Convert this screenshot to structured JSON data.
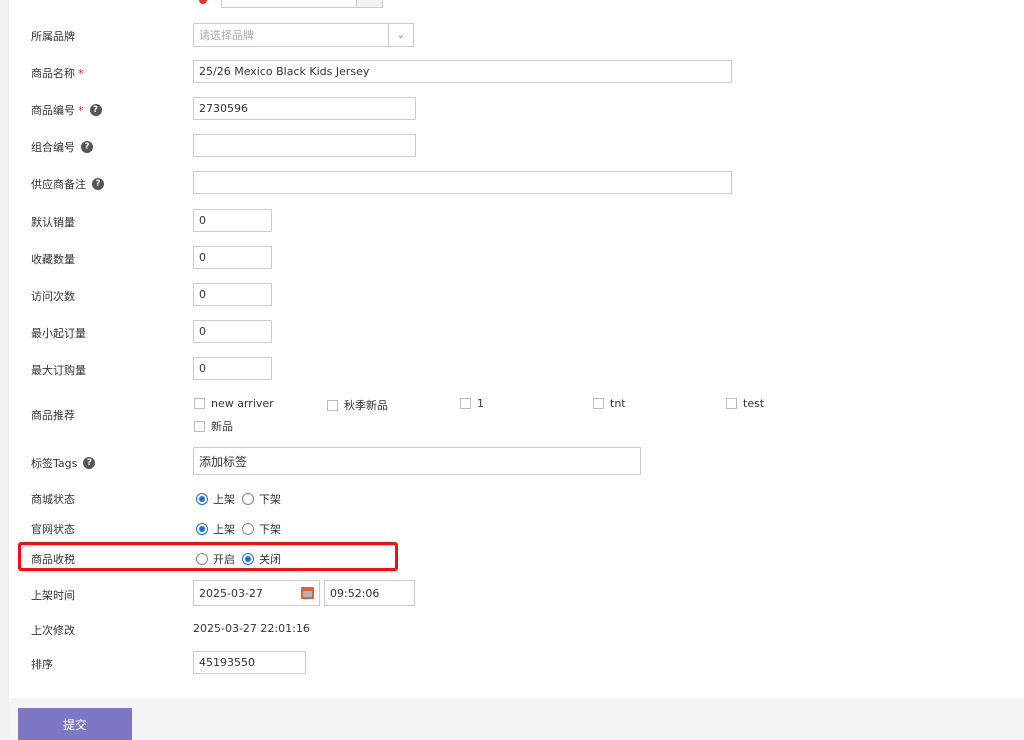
{
  "form": {
    "brand": {
      "label": "所属品牌",
      "placeholder": "请选择品牌"
    },
    "name": {
      "label": "商品名称",
      "required": "*",
      "value": "25/26 Mexico Black Kids Jersey"
    },
    "code": {
      "label": "商品编号",
      "required": "*",
      "value": "2730596"
    },
    "combo_code": {
      "label": "组合编号",
      "value": ""
    },
    "supplier_note": {
      "label": "供应商备注",
      "value": ""
    },
    "default_sales": {
      "label": "默认销量",
      "value": "0"
    },
    "favorites": {
      "label": "收藏数量",
      "value": "0"
    },
    "visits": {
      "label": "访问次数",
      "value": "0"
    },
    "min_order": {
      "label": "最小起订量",
      "value": "0"
    },
    "max_order": {
      "label": "最大订购量",
      "value": "0"
    },
    "recommend": {
      "label": "商品推荐",
      "options": [
        "new arriver",
        "秋季新品",
        "1",
        "tnt",
        "test",
        "新品"
      ]
    },
    "tags": {
      "label": "标签Tags",
      "placeholder": "添加标签"
    },
    "mall_status": {
      "label": "商城状态",
      "on": "上架",
      "off": "下架",
      "selected": "上架"
    },
    "site_status": {
      "label": "官网状态",
      "on": "上架",
      "off": "下架",
      "selected": "上架"
    },
    "tax": {
      "label": "商品收税",
      "on": "开启",
      "off": "关闭",
      "selected": "关闭"
    },
    "listing_time": {
      "label": "上架时间",
      "date": "2025-03-27",
      "time": "09:52:06"
    },
    "last_modified": {
      "label": "上次修改",
      "value": "2025-03-27 22:01:16"
    },
    "sort": {
      "label": "排序",
      "value": "45193550"
    }
  },
  "submit_label": "提交",
  "colors": {
    "accent": "#7e78c4",
    "radio": "#1a6ee0",
    "highlight": "#f01010",
    "required": "#e02020"
  }
}
